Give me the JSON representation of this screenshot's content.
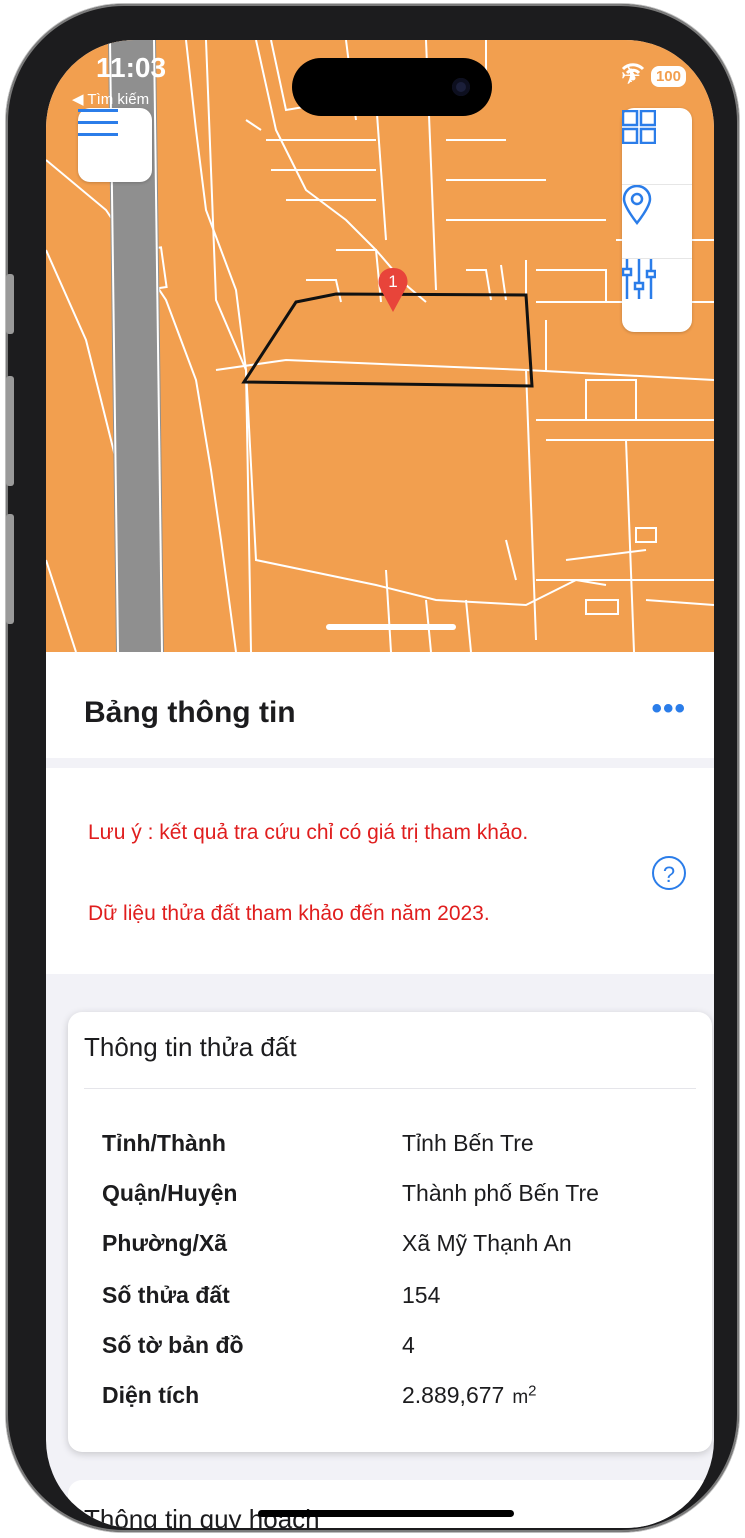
{
  "status_bar": {
    "time": "11:03",
    "back_label": "◀ Tìm kiếm",
    "battery": "100"
  },
  "map": {
    "marker_label": "1"
  },
  "sheet": {
    "title": "Bảng thông tin",
    "more_label": "•••"
  },
  "notice": {
    "line1": "Lưu ý : kết quả tra cứu chỉ có giá trị tham khảo.",
    "line2": "Dữ liệu thửa đất tham khảo đến năm 2023.",
    "help_label": "?"
  },
  "parcel_card": {
    "title": "Thông tin thửa đất",
    "rows": [
      {
        "label": "Tỉnh/Thành",
        "value": "Tỉnh Bến Tre"
      },
      {
        "label": "Quận/Huyện",
        "value": "Thành phố Bến Tre"
      },
      {
        "label": "Phường/Xã",
        "value": "Xã Mỹ Thạnh An"
      },
      {
        "label": "Số thửa đất",
        "value": "154"
      },
      {
        "label": "Số tờ bản đồ",
        "value": "4"
      },
      {
        "label": "Diện tích",
        "value": "2.889,677",
        "unit": "m",
        "unit_sup": "2"
      }
    ]
  },
  "planning_card": {
    "title": "Thông tin quy hoạch"
  },
  "colors": {
    "map_fill": "#f29f4f",
    "road": "#8f8f8f",
    "accent": "#2b7de9",
    "warning": "#e01e1e"
  },
  "icons": {
    "menu": "hamburger-icon",
    "layers": "grid-icon",
    "location": "location-pin-icon",
    "filter": "sliders-icon"
  }
}
